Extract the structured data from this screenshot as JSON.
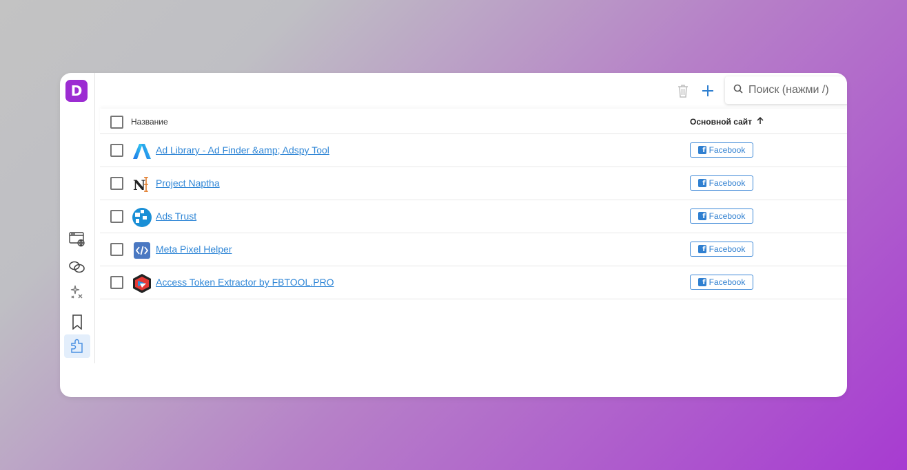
{
  "app": {
    "logo_letter": "D",
    "brand_color": "#9c2cd2",
    "accent_color": "#2f7fd0"
  },
  "sidebar": {
    "items": [
      {
        "icon": "web-browser-icon",
        "active": false
      },
      {
        "icon": "link-icon",
        "active": false
      },
      {
        "icon": "sparkle-clear-icon",
        "active": false
      },
      {
        "icon": "bookmark-icon",
        "active": false
      },
      {
        "icon": "extension-puzzle-icon",
        "active": true
      }
    ]
  },
  "toolbar": {
    "delete_icon": "trash-icon",
    "add_icon": "plus-icon",
    "search_placeholder": "Поиск (нажми /)",
    "search_value": ""
  },
  "table": {
    "columns": {
      "name": "Название",
      "site": "Основной сайт",
      "sort": "ascending"
    },
    "rows": [
      {
        "name": "Ad Library - Ad Finder &amp; Adspy Tool",
        "icon": "ad-library-icon",
        "site": "Facebook"
      },
      {
        "name": "Project Naptha",
        "icon": "project-naptha-icon",
        "site": "Facebook"
      },
      {
        "name": "Ads Trust",
        "icon": "ads-trust-icon",
        "site": "Facebook"
      },
      {
        "name": "Meta Pixel Helper",
        "icon": "meta-pixel-helper-icon",
        "site": "Facebook"
      },
      {
        "name": "Access Token Extractor by FBTOOL.PRO",
        "icon": "access-token-extractor-icon",
        "site": "Facebook"
      }
    ]
  }
}
